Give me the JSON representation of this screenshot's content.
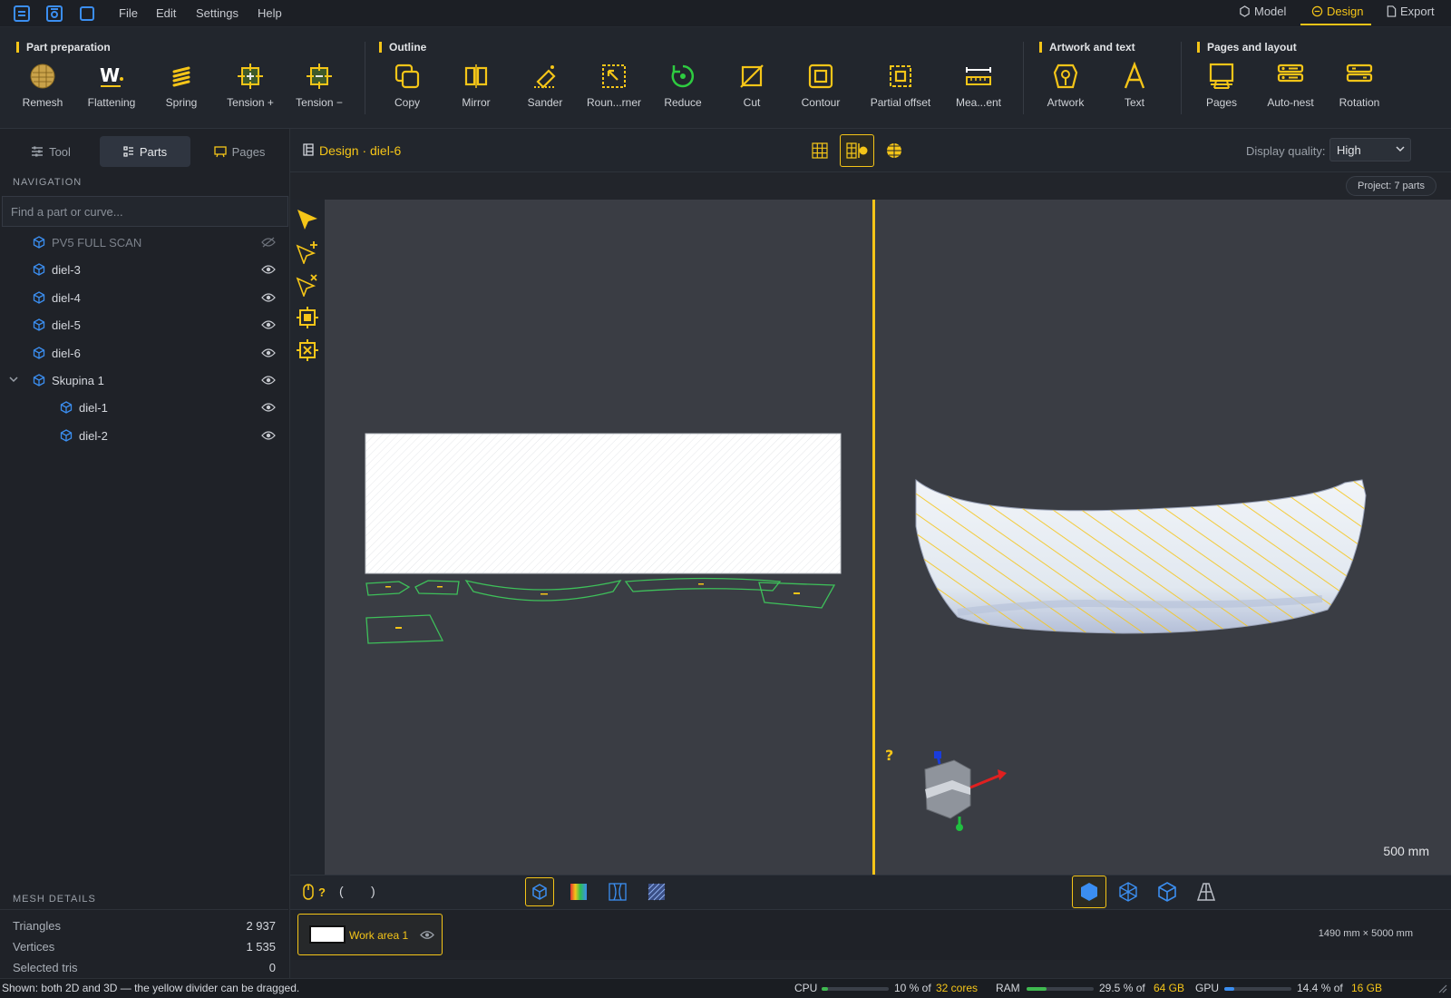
{
  "menubar": {
    "items": [
      "File",
      "Edit",
      "Settings",
      "Help"
    ],
    "modes": [
      {
        "label": "Model",
        "icon": "model-icon"
      },
      {
        "label": "Design",
        "icon": "design-icon"
      },
      {
        "label": "Export",
        "icon": "export-icon"
      }
    ],
    "active_mode": "Design"
  },
  "ribbon": {
    "groups": {
      "part_preparation": "Part preparation",
      "outline": "Outline",
      "artwork_text": "Artwork and text",
      "pages_layout": "Pages and layout"
    },
    "tools": {
      "remesh": "Remesh",
      "flattening": "Flattening",
      "spring": "Spring",
      "tension_plus": "Tension +",
      "tension_minus": "Tension −",
      "copy": "Copy",
      "mirror": "Mirror",
      "sander": "Sander",
      "rounder": "Roun...rner",
      "reduce": "Reduce",
      "cut": "Cut",
      "contour": "Contour",
      "partial_offset": "Partial offset",
      "measurement": "Mea...ent",
      "artwork": "Artwork",
      "text": "Text",
      "pages": "Pages",
      "auto_nest": "Auto-nest",
      "rotation": "Rotation"
    }
  },
  "left_panel": {
    "tabs": [
      "Tool",
      "Parts",
      "Pages"
    ],
    "active_tab": "Parts",
    "navigation_title": "NAVIGATION",
    "search_placeholder": "Find a part or curve...",
    "tree": [
      {
        "name": "PV5 FULL SCAN",
        "visible": false,
        "level": 0
      },
      {
        "name": "diel-3",
        "visible": true,
        "level": 0
      },
      {
        "name": "diel-4",
        "visible": true,
        "level": 0
      },
      {
        "name": "diel-5",
        "visible": true,
        "level": 0
      },
      {
        "name": "diel-6",
        "visible": true,
        "level": 0
      },
      {
        "name": "Skupina 1",
        "visible": true,
        "level": 0,
        "expanded": true
      },
      {
        "name": "diel-1",
        "visible": true,
        "level": 1
      },
      {
        "name": "diel-2",
        "visible": true,
        "level": 1
      }
    ],
    "mesh_details": {
      "title": "MESH DETAILS",
      "rows": [
        {
          "label": "Triangles",
          "value": "2 937"
        },
        {
          "label": "Vertices",
          "value": "1 535"
        },
        {
          "label": "Selected tris",
          "value": "0"
        }
      ]
    }
  },
  "viewport": {
    "title": "Design · diel-6",
    "display_quality_label": "Display quality:",
    "display_quality_value": "High",
    "project_badge": "Project: 7 parts",
    "scale_label": "500 mm",
    "help_mark": "?",
    "mouse_help": "?",
    "bracket_left": "(",
    "bracket_right": ")"
  },
  "work_area": {
    "label": "Work area 1",
    "dimensions": "1490 mm × 5000 mm"
  },
  "statusbar": {
    "message": "Shown: both 2D and 3D — the yellow divider can be dragged.",
    "cpu_label": "CPU",
    "cpu_text": "10 % of",
    "cpu_total": "32 cores",
    "cpu_fraction": 0.1,
    "ram_label": "RAM",
    "ram_text": "29.5 % of",
    "ram_total": "64 GB",
    "ram_fraction": 0.295,
    "gpu_label": "GPU",
    "gpu_text": "14.4 % of",
    "gpu_total": "16 GB",
    "gpu_fraction": 0.144
  },
  "colors": {
    "accent": "#f5c518",
    "part_outline": "#3ec05a",
    "icon_blue": "#3b8ef0"
  }
}
